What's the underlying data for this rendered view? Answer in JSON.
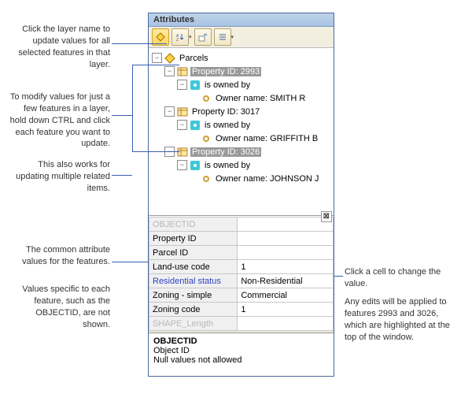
{
  "window": {
    "title": "Attributes"
  },
  "toolbar": {
    "flash_tip": "Flash selected",
    "sort_tip": "Sort",
    "promote_tip": "Promote",
    "options_tip": "Options"
  },
  "tree": {
    "root": "Parcels",
    "items": [
      {
        "pid": "Property ID: 2993",
        "rel": "is owned by",
        "owner": "Owner name: SMITH R",
        "selected": true
      },
      {
        "pid": "Property ID: 3017",
        "rel": "is owned by",
        "owner": "Owner name: GRIFFITH B",
        "selected": false
      },
      {
        "pid": "Property ID: 3026",
        "rel": "is owned by",
        "owner": "Owner name: JOHNSON J",
        "selected": true
      }
    ]
  },
  "related_toggle": "⊠",
  "grid": {
    "rows": [
      {
        "field": "OBJECTID",
        "value": "",
        "style": "dim"
      },
      {
        "field": "Property ID",
        "value": "",
        "style": "propid"
      },
      {
        "field": "Parcel ID",
        "value": "",
        "style": ""
      },
      {
        "field": "Land-use code",
        "value": "1",
        "style": ""
      },
      {
        "field": "Residential status",
        "value": "Non-Residential",
        "style": "resstat"
      },
      {
        "field": "Zoning - simple",
        "value": "Commercial",
        "style": "zon"
      },
      {
        "field": "Zoning code",
        "value": "1",
        "style": ""
      },
      {
        "field": "SHAPE_Length",
        "value": "",
        "style": "dim"
      }
    ]
  },
  "desc": {
    "title": "OBJECTID",
    "sub": "Object ID",
    "note": "Null values not allowed"
  },
  "ann": {
    "a1": "Click the layer name to update values for all selected features in that layer.",
    "a2": "To modify values for just a few features in a layer, hold down CTRL and click each feature you want to update.",
    "a3": "This also works for updating multiple related items.",
    "a4": "The common attribute values for the features.",
    "a5": "Values specific to each feature, such as the OBJECTID, are not shown.",
    "a6": "Click a cell to change the value.",
    "a7": "Any edits will be applied to features 2993 and 3026, which are highlighted at the top of the window."
  }
}
